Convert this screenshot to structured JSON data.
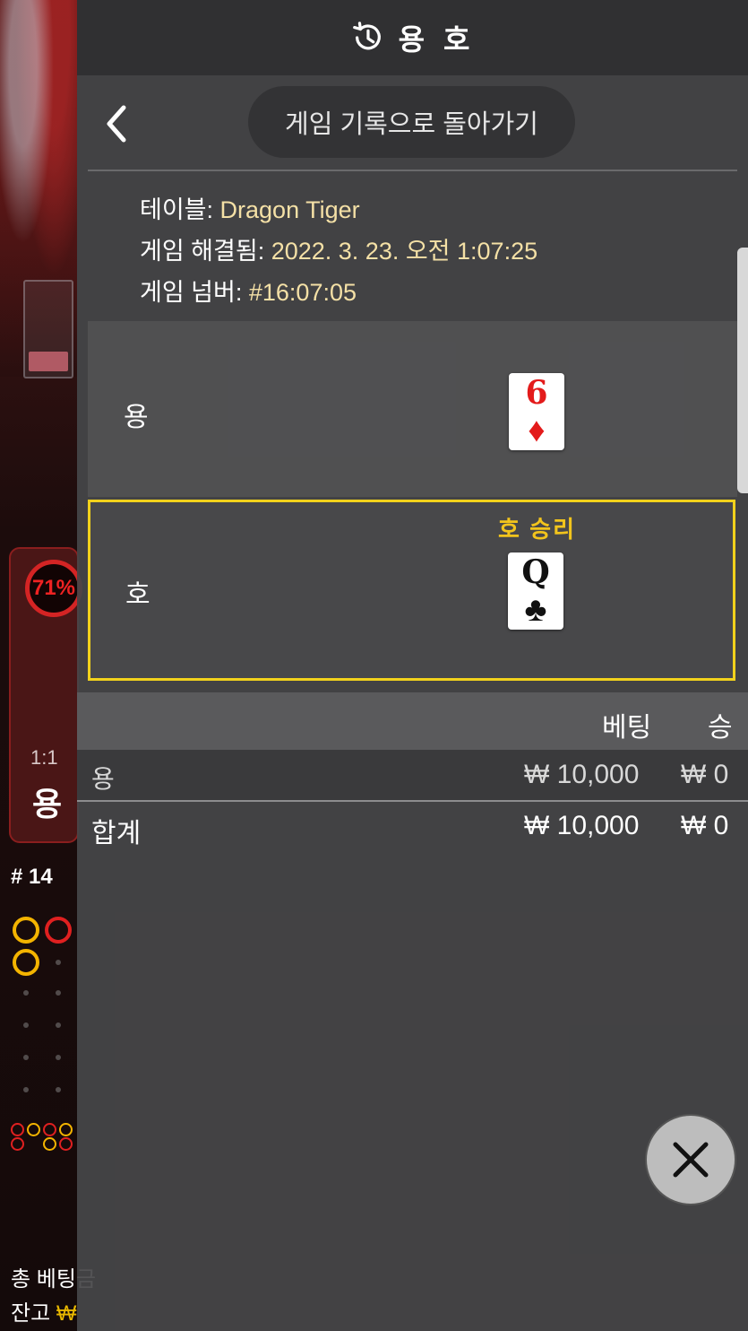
{
  "header": {
    "title": "용 호"
  },
  "back": {
    "label": "게임 기록으로 돌아가기"
  },
  "game_info": {
    "table_label": "테이블: ",
    "table_value": "Dragon Tiger",
    "resolved_label": "게임 해결됨: ",
    "resolved_value": "2022. 3. 23. 오전 1:07:25",
    "number_label": "게임 넘버: ",
    "number_value": "#16:07:05"
  },
  "hands": {
    "dragon": {
      "label": "용",
      "card_rank": "6",
      "card_suit": "♦",
      "card_color": "#e31b1b"
    },
    "tiger": {
      "label": "호",
      "card_rank": "Q",
      "card_suit": "♣",
      "card_color": "#111111",
      "result": "호 승리"
    }
  },
  "bets_table": {
    "columns": [
      "베팅",
      "승"
    ],
    "rows": [
      {
        "name": "용",
        "bet": "₩ 10,000",
        "win": "₩ 0"
      }
    ],
    "total": {
      "name": "합계",
      "bet": "₩ 10,000",
      "win": "₩ 0"
    }
  },
  "background": {
    "dragon_percent": "71%",
    "ratio": "1:1",
    "bet_label": "용",
    "round": "# 14",
    "total_bet_label": "총 베팅금",
    "balance_label": "잔고",
    "balance_currency": "₩"
  },
  "icons": {
    "history": "history-clock-icon",
    "back": "chevron-left-icon",
    "close": "close-icon"
  },
  "colors": {
    "accent_gold": "#f2d21c",
    "win_text": "#f2c41c",
    "meta_value": "#f4e0a6",
    "dragon_red": "#d42424"
  }
}
